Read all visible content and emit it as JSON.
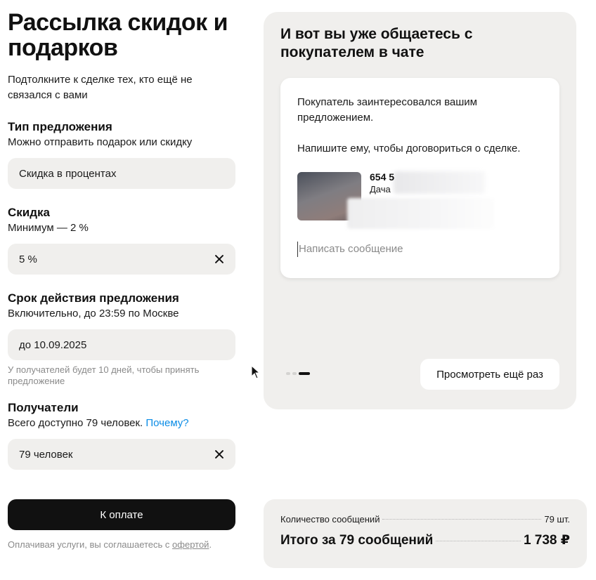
{
  "form": {
    "title": "Рассылка скидок и подарков",
    "subtitle": "Подтолкните к сделке тех, кто ещё не связался с вами",
    "offer_type": {
      "heading": "Тип предложения",
      "description": "Можно отправить подарок или скидку",
      "value": "Скидка в процентах"
    },
    "discount": {
      "heading": "Скидка",
      "description": "Минимум — 2 %",
      "value": "5 %"
    },
    "validity": {
      "heading": "Срок действия предложения",
      "description": "Включительно, до 23:59 по Москве",
      "value": "до 10.09.2025",
      "hint": "У получателей будет 10 дней, чтобы принять предложение"
    },
    "recipients": {
      "heading": "Получатели",
      "description": "Всего доступно 79 человек.",
      "why_link": "Почему?",
      "value": "79 человек"
    },
    "pay_button": "К оплате",
    "terms_prefix": "Оплачивая услуги, вы соглашаетесь с",
    "terms_link": "офертой",
    "terms_suffix": "."
  },
  "preview": {
    "title": "И вот вы уже общаетесь с покупателем в чате",
    "message_line1": "Покупатель заинтересовался вашим предложением.",
    "message_line2": "Напишите ему, чтобы договориться о сделке.",
    "listing_price": "654 5",
    "listing_category": "Дача",
    "input_placeholder": "Написать сообщение",
    "slides_total": 3,
    "slide_active": 3,
    "replay_button": "Просмотреть ещё раз"
  },
  "summary": {
    "count_label": "Количество сообщений",
    "count_value": "79 шт.",
    "total_label": "Итого за 79 сообщений",
    "total_value": "1 738 ₽"
  }
}
